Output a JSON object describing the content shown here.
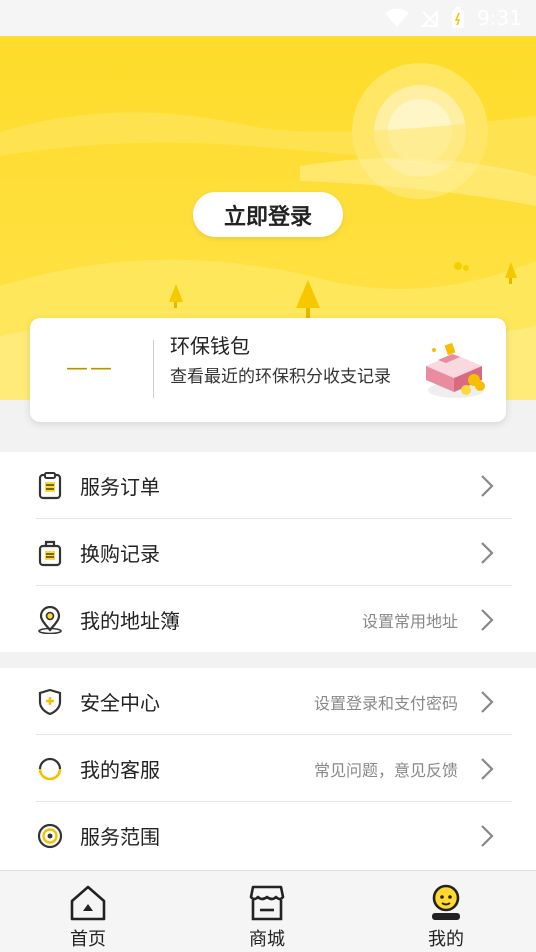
{
  "status_bar": {
    "time": "9:31"
  },
  "hero": {
    "login_label": "立即登录"
  },
  "wallet": {
    "dash": "——",
    "title": "环保钱包",
    "description": "查看最近的环保积分收支记录"
  },
  "menu_group1": [
    {
      "label": "服务订单",
      "hint": "",
      "icon": "clipboard-icon"
    },
    {
      "label": "换购记录",
      "hint": "",
      "icon": "bag-icon"
    },
    {
      "label": "我的地址簿",
      "hint": "设置常用地址",
      "icon": "location-icon"
    }
  ],
  "menu_group2": [
    {
      "label": "安全中心",
      "hint": "设置登录和支付密码",
      "icon": "shield-icon"
    },
    {
      "label": "我的客服",
      "hint": "常见问题，意见反馈",
      "icon": "headset-icon"
    },
    {
      "label": "服务范围",
      "hint": "",
      "icon": "target-icon"
    }
  ],
  "tabbar": {
    "home_label": "首页",
    "shop_label": "商城",
    "mine_label": "我的"
  },
  "colors": {
    "accent": "#FFD92E",
    "accent_dark": "#F5C000"
  }
}
